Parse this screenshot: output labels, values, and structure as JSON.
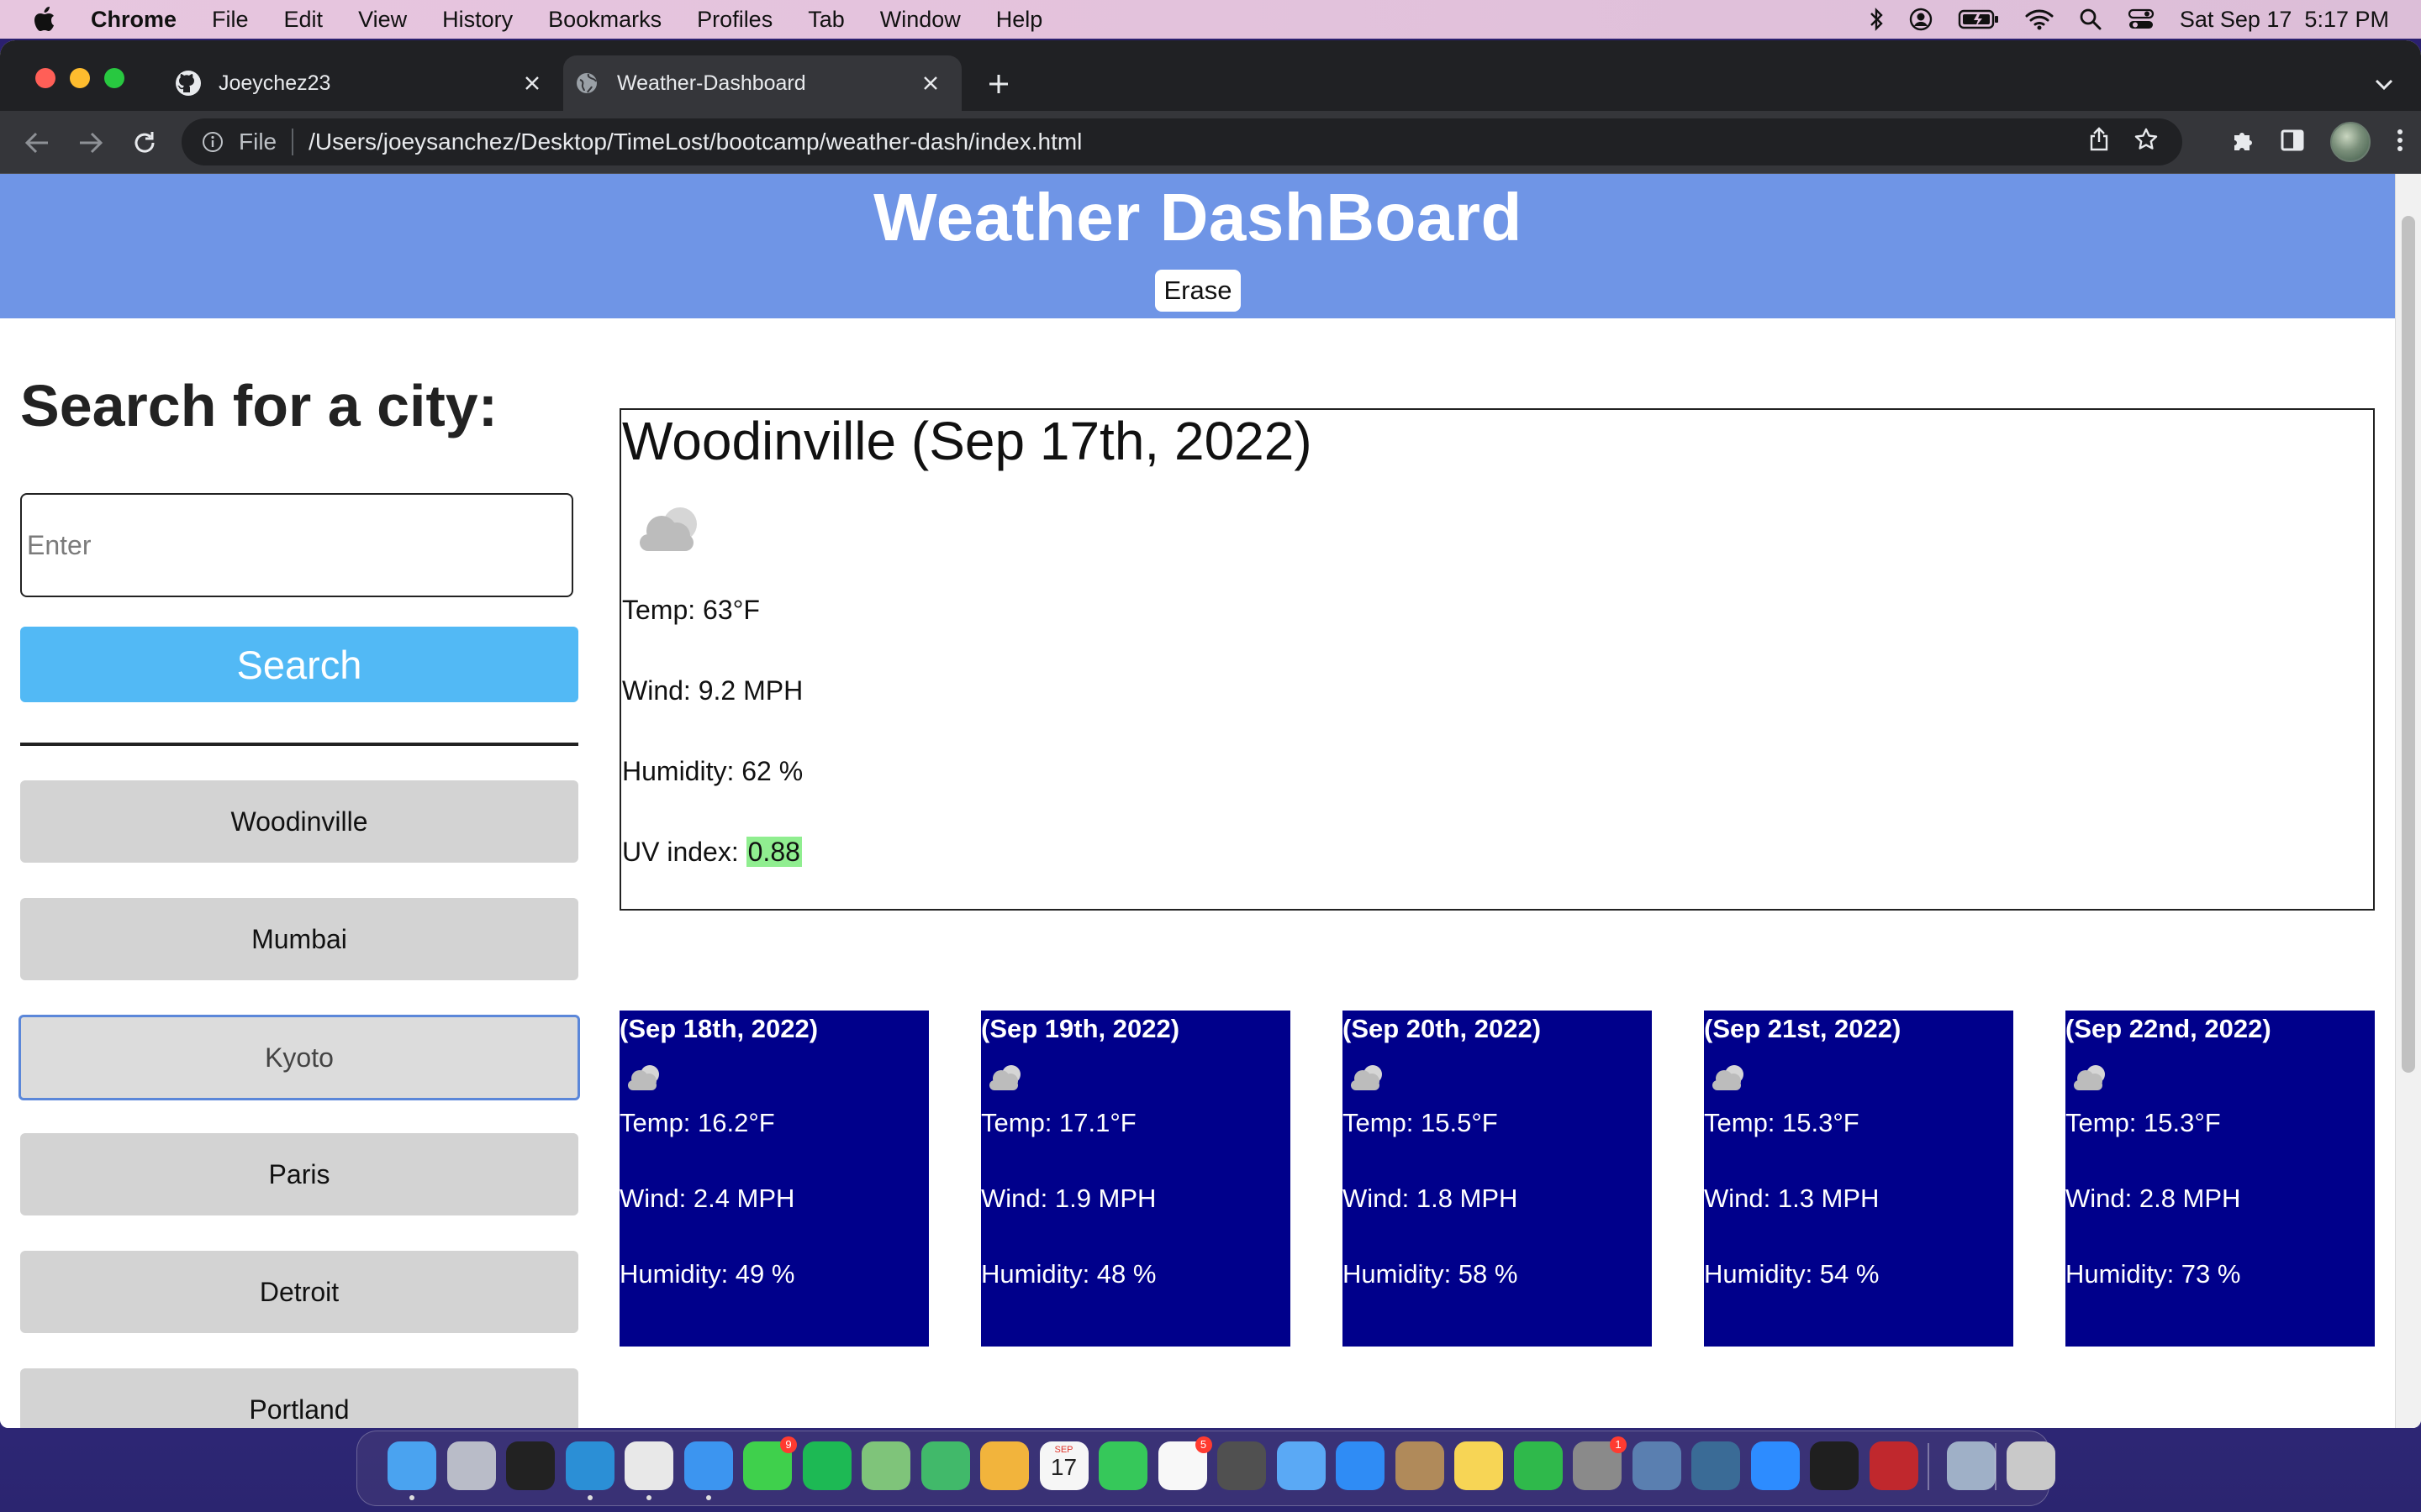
{
  "menubar": {
    "app_name": "Chrome",
    "items": [
      "File",
      "Edit",
      "View",
      "History",
      "Bookmarks",
      "Profiles",
      "Tab",
      "Window",
      "Help"
    ],
    "clock": "Sat Sep 17  5:17 PM",
    "status_icons": [
      "bluetooth-icon",
      "user-icon",
      "battery-icon",
      "wifi-icon",
      "search-icon",
      "control-center-icon"
    ]
  },
  "browser": {
    "tabs": [
      {
        "title": "Joeychez23",
        "favicon": "github-icon",
        "active": false
      },
      {
        "title": "Weather-Dashboard",
        "favicon": "globe-icon",
        "active": true
      }
    ],
    "address": {
      "scheme_label": "File",
      "url": "/Users/joeysanchez/Desktop/TimeLost/bootcamp/weather-dash/index.html"
    }
  },
  "page": {
    "header": {
      "title": "Weather DashBoard",
      "erase_label": "Erase",
      "background": "#6f95e6"
    },
    "search": {
      "heading": "Search for a city:",
      "placeholder": "Enter",
      "value": "",
      "button_label": "Search",
      "button_color": "#52b9f5"
    },
    "history": [
      "Woodinville",
      "Mumbai",
      "Kyoto",
      "Paris",
      "Detroit",
      "Portland"
    ],
    "current": {
      "title": "Woodinville (Sep 17th, 2022)",
      "icon": "cloud-icon",
      "temp": "Temp: 63°F",
      "wind": "Wind: 9.2 MPH",
      "humidity": "Humidity: 62 %",
      "uv_label": "UV index: ",
      "uv_value": "0.88",
      "uv_color": "#90ee90"
    },
    "forecast": [
      {
        "date": "(Sep 18th, 2022)",
        "icon": "cloud-icon",
        "temp": "Temp: 16.2°F",
        "wind": "Wind: 2.4 MPH",
        "humidity": "Humidity: 49 %"
      },
      {
        "date": "(Sep 19th, 2022)",
        "icon": "cloud-icon",
        "temp": "Temp: 17.1°F",
        "wind": "Wind: 1.9 MPH",
        "humidity": "Humidity: 48 %"
      },
      {
        "date": "(Sep 20th, 2022)",
        "icon": "cloud-icon",
        "temp": "Temp: 15.5°F",
        "wind": "Wind: 1.8 MPH",
        "humidity": "Humidity: 58 %"
      },
      {
        "date": "(Sep 21st, 2022)",
        "icon": "cloud-icon",
        "temp": "Temp: 15.3°F",
        "wind": "Wind: 1.3 MPH",
        "humidity": "Humidity: 54 %"
      },
      {
        "date": "(Sep 22nd, 2022)",
        "icon": "cloud-icon",
        "temp": "Temp: 15.3°F",
        "wind": "Wind: 2.8 MPH",
        "humidity": "Humidity: 73 %"
      }
    ],
    "forecast_color": "#00008b"
  },
  "dock": {
    "apps": [
      {
        "name": "finder-icon",
        "color": "#4aa3f0"
      },
      {
        "name": "launchpad-icon",
        "color": "#b9bcc8"
      },
      {
        "name": "terminal-icon",
        "color": "#222222"
      },
      {
        "name": "vscode-icon",
        "color": "#2b8fd6"
      },
      {
        "name": "chrome-icon",
        "color": "#e8e8e8"
      },
      {
        "name": "safari-icon",
        "color": "#3c95f0"
      },
      {
        "name": "messages-icon",
        "color": "#3fd04c",
        "badge": "9"
      },
      {
        "name": "spotify-icon",
        "color": "#1db954"
      },
      {
        "name": "maps-icon",
        "color": "#7fc47a"
      },
      {
        "name": "find-my-icon",
        "color": "#41b96a"
      },
      {
        "name": "photos-icon",
        "color": "#f2b43c"
      },
      {
        "name": "calendar-icon",
        "color": "#f6f6f6",
        "label": "17",
        "sublabel": "SEP"
      },
      {
        "name": "facetime-icon",
        "color": "#36c85a"
      },
      {
        "name": "reminders-icon",
        "color": "#f8f8f8",
        "badge": "5"
      },
      {
        "name": "calculator-icon",
        "color": "#505050"
      },
      {
        "name": "mail-icon",
        "color": "#5aa9f5"
      },
      {
        "name": "app-store-icon",
        "color": "#2f8cf5"
      },
      {
        "name": "contacts-icon",
        "color": "#b08a5a"
      },
      {
        "name": "notes-icon",
        "color": "#f7d555"
      },
      {
        "name": "numbers-icon",
        "color": "#2fb94b"
      },
      {
        "name": "system-preferences-icon",
        "color": "#8a8a8a",
        "badge": "1"
      },
      {
        "name": "mysql-workbench-icon",
        "color": "#5a7fb0"
      },
      {
        "name": "mysql-icon",
        "color": "#3a6b96"
      },
      {
        "name": "zoom-icon",
        "color": "#2d8cff"
      },
      {
        "name": "activity-monitor-icon",
        "color": "#1f1f1f"
      },
      {
        "name": "filezilla-icon",
        "color": "#c0282d"
      },
      {
        "name": "preview-icon",
        "color": "#9fb0c7"
      },
      {
        "name": "trash-icon",
        "color": "#c9c9c9"
      }
    ]
  }
}
